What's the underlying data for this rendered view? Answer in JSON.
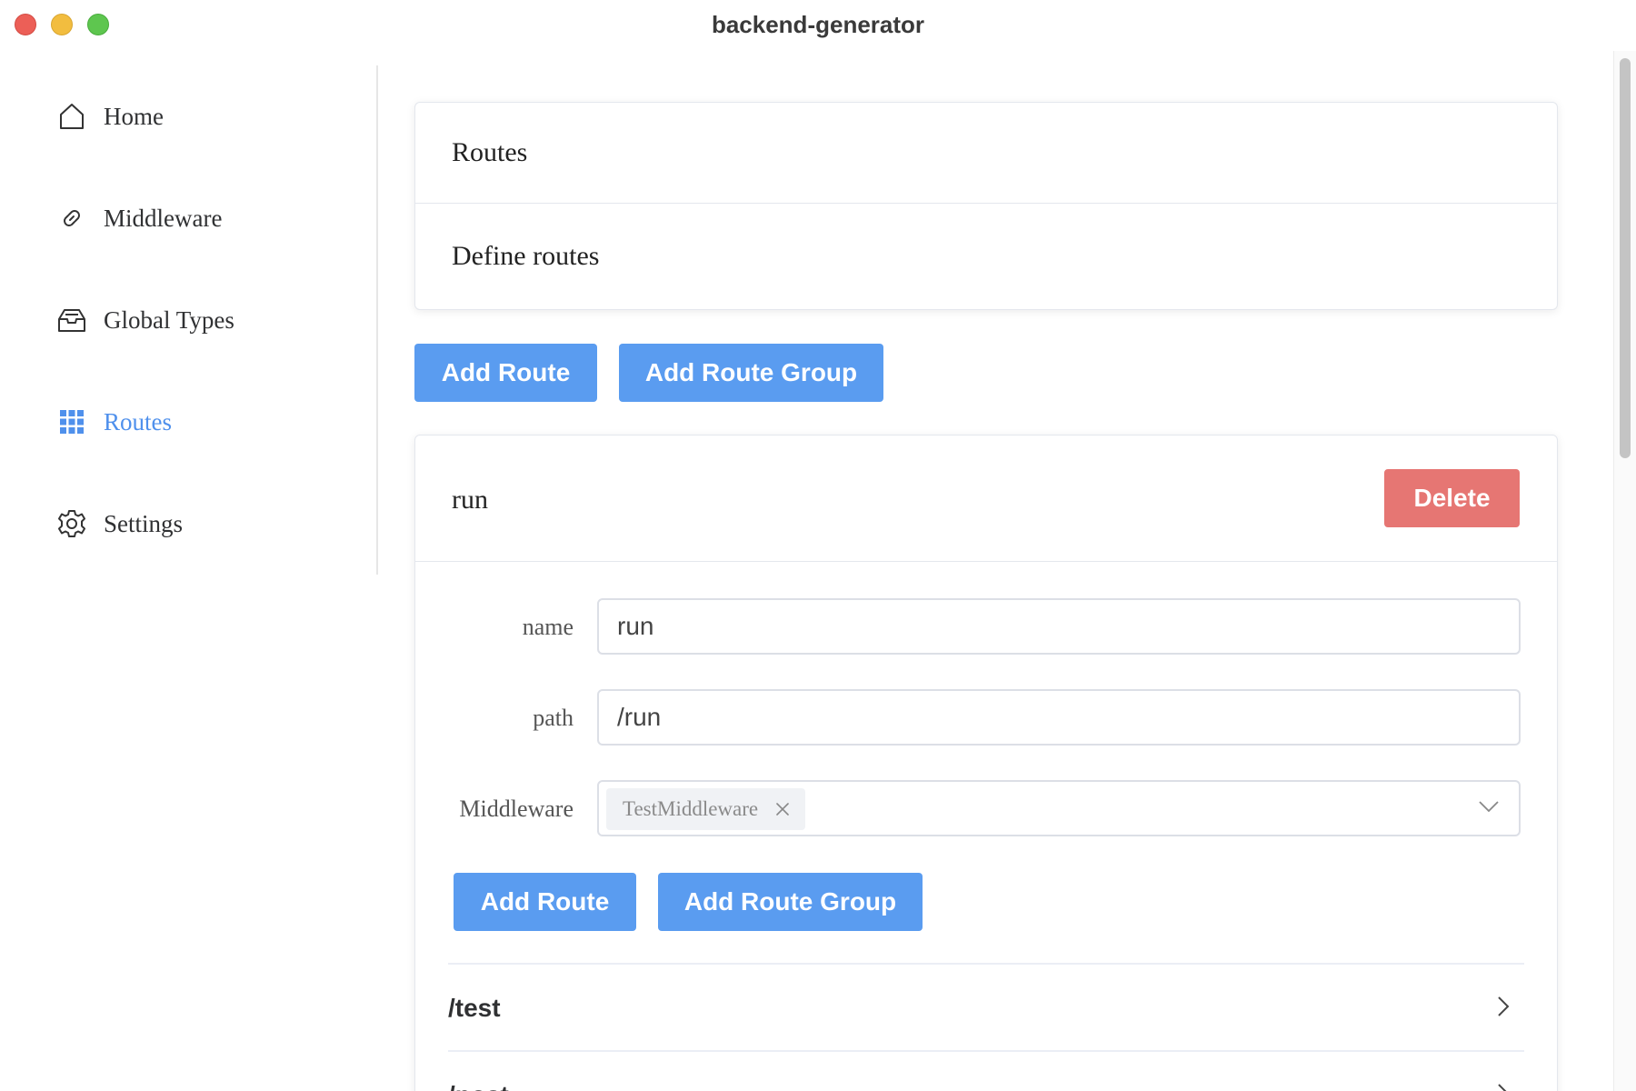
{
  "window": {
    "title": "backend-generator"
  },
  "sidebar": {
    "items": [
      {
        "label": "Home",
        "icon": "home-icon",
        "active": false
      },
      {
        "label": "Middleware",
        "icon": "link-icon",
        "active": false
      },
      {
        "label": "Global Types",
        "icon": "inbox-icon",
        "active": false
      },
      {
        "label": "Routes",
        "icon": "grid-icon",
        "active": true
      },
      {
        "label": "Settings",
        "icon": "gear-icon",
        "active": false
      }
    ]
  },
  "header_card": {
    "title": "Routes",
    "description": "Define routes"
  },
  "toolbar": {
    "add_route_label": "Add Route",
    "add_route_group_label": "Add Route Group"
  },
  "route_card": {
    "title": "run",
    "delete_label": "Delete",
    "form": {
      "name_label": "name",
      "name_value": "run",
      "path_label": "path",
      "path_value": "/run",
      "middleware_label": "Middleware",
      "middleware_tags": [
        "TestMiddleware"
      ]
    },
    "add_route_label": "Add Route",
    "add_route_group_label": "Add Route Group",
    "children": [
      {
        "path": "/test"
      },
      {
        "path": "/post"
      }
    ]
  },
  "colors": {
    "accent": "#5a9cf0",
    "active_nav": "#4f90ec",
    "danger": "#e67673"
  }
}
